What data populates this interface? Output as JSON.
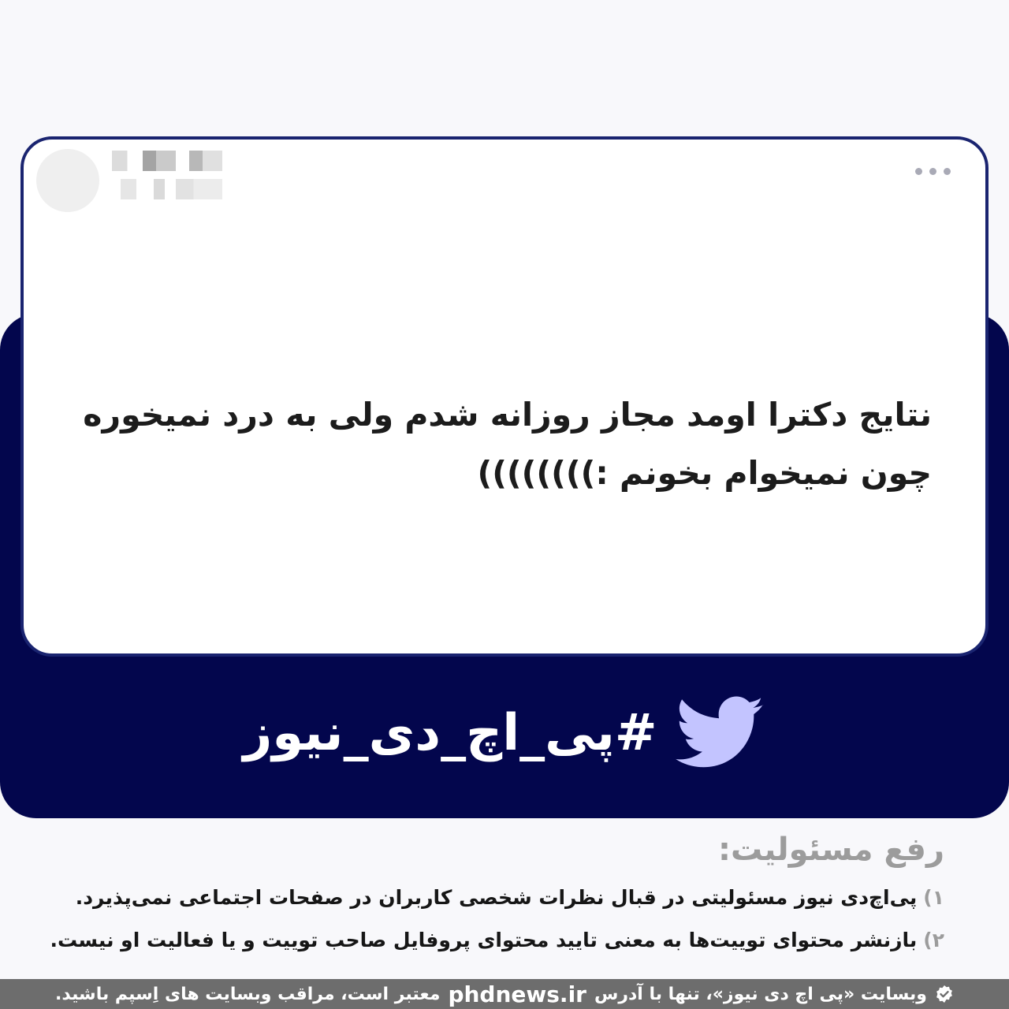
{
  "colors": {
    "navy": "#03064d",
    "card_border": "#1a2470",
    "bird": "#c3c4ff",
    "footer": "#6d6d6d",
    "muted": "#9c9c9c"
  },
  "tweet": {
    "text": "نتایج دکترا اومد مجاز روزانه شدم ولی به درد نمیخوره چون نمیخوام بخونم :))))))))",
    "icons": [
      "more-dots-icon"
    ]
  },
  "brand": {
    "hashtag": "#پی_اچ_دی_نیوز",
    "icon": "twitter-bird-icon"
  },
  "disclaimer": {
    "title": "رفع مسئولیت:",
    "items": [
      {
        "num": "۱)",
        "text": "پی‌اچ‌دی نیوز مسئولیتی در قبال نظرات شخصی کاربران در صفحات اجتماعی نمی‌پذیرد."
      },
      {
        "num": "۲)",
        "text": "بازنشر محتوای توییت‌ها به معنی تایید محتوای پروفایل صاحب توییت و یا فعالیت او نیست."
      }
    ]
  },
  "footer": {
    "before": "وبسایت «پی اچ دی نیوز»، تنها با آدرس",
    "domain": "phdnews.ir",
    "after": "معتبر است، مراقب وبسایت های اِسپم باشید.",
    "icon": "verified-check-icon"
  }
}
